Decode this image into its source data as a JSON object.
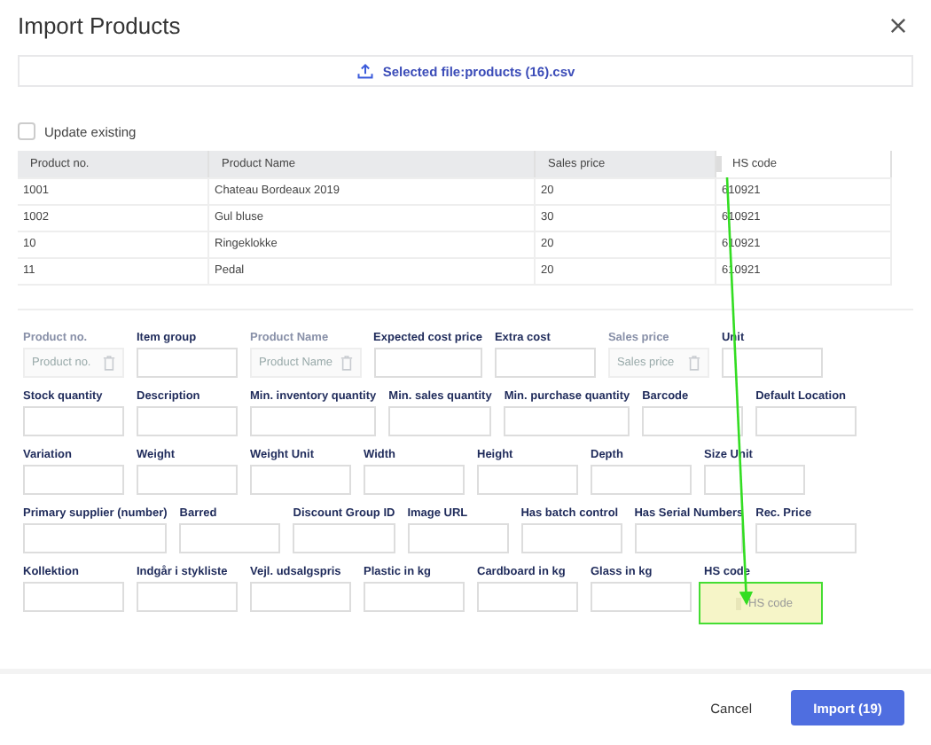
{
  "dialog": {
    "title": "Import Products"
  },
  "upload": {
    "label": "Selected file:products (16).csv"
  },
  "update_existing": {
    "label": "Update existing",
    "checked": false
  },
  "table": {
    "columns": [
      {
        "label": "Product no.",
        "dragging": false
      },
      {
        "label": "Product Name",
        "dragging": false
      },
      {
        "label": "Sales price",
        "dragging": false
      },
      {
        "label": "HS code",
        "dragging": true
      }
    ],
    "rows": [
      [
        "1001",
        "Chateau Bordeaux 2019",
        "20",
        "610921"
      ],
      [
        "1002",
        "Gul bluse",
        "30",
        "610921"
      ],
      [
        "10",
        "Ringeklokke",
        "20",
        "610921"
      ],
      [
        "11",
        "Pedal",
        "20",
        "610921"
      ]
    ]
  },
  "field_rows": [
    [
      {
        "label": "Product no.",
        "kind": "mapped",
        "placeholder": "Product no."
      },
      {
        "label": "Item group",
        "kind": "empty"
      },
      {
        "label": "Product Name",
        "kind": "mapped",
        "placeholder": "Product Name"
      },
      {
        "label": "Expected cost price",
        "kind": "empty"
      },
      {
        "label": "Extra cost",
        "kind": "empty"
      },
      {
        "label": "Sales price",
        "kind": "mapped",
        "placeholder": "Sales price"
      },
      {
        "label": "Unit",
        "kind": "empty"
      }
    ],
    [
      {
        "label": "Stock quantity",
        "kind": "empty"
      },
      {
        "label": "Description",
        "kind": "empty"
      },
      {
        "label": "Min. inventory quantity",
        "kind": "empty"
      },
      {
        "label": "Min. sales quantity",
        "kind": "empty"
      },
      {
        "label": "Min. purchase quantity",
        "kind": "empty"
      },
      {
        "label": "Barcode",
        "kind": "empty"
      },
      {
        "label": "Default Location",
        "kind": "empty"
      }
    ],
    [
      {
        "label": "Variation",
        "kind": "empty"
      },
      {
        "label": "Weight",
        "kind": "empty"
      },
      {
        "label": "Weight Unit",
        "kind": "empty"
      },
      {
        "label": "Width",
        "kind": "empty"
      },
      {
        "label": "Height",
        "kind": "empty"
      },
      {
        "label": "Depth",
        "kind": "empty"
      },
      {
        "label": "Size Unit",
        "kind": "empty"
      }
    ],
    [
      {
        "label": "Primary supplier (number)",
        "kind": "empty"
      },
      {
        "label": "Barred",
        "kind": "empty"
      },
      {
        "label": "Discount Group ID",
        "kind": "empty"
      },
      {
        "label": "Image URL",
        "kind": "empty"
      },
      {
        "label": "Has batch control",
        "kind": "empty"
      },
      {
        "label": "Has Serial Numbers",
        "kind": "empty"
      },
      {
        "label": "Rec. Price",
        "kind": "empty"
      }
    ],
    [
      {
        "label": "Kollektion",
        "kind": "empty"
      },
      {
        "label": "Indgår i stykliste",
        "kind": "empty"
      },
      {
        "label": "Vejl. udsalgspris",
        "kind": "empty"
      },
      {
        "label": "Plastic in kg",
        "kind": "empty"
      },
      {
        "label": "Cardboard in kg",
        "kind": "empty"
      },
      {
        "label": "Glass in kg",
        "kind": "empty"
      },
      {
        "label": "HS code",
        "kind": "drop-target",
        "placeholder": "HS code"
      }
    ]
  ],
  "buttons": {
    "cancel": "Cancel",
    "import": "Import (19)"
  }
}
